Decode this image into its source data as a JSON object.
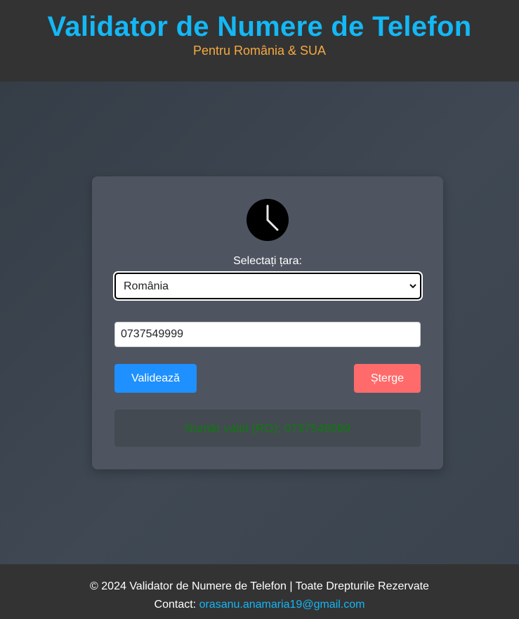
{
  "header": {
    "title": "Validator de Numere de Telefon",
    "subtitle": "Pentru România & SUA"
  },
  "form": {
    "icon": "clock-icon",
    "country_label": "Selectați țara:",
    "country_selected": "România",
    "phone_value": "0737549999",
    "validate_label": "Validează",
    "clear_label": "Șterge",
    "result_text": "Număr valid (RO): 0737549999"
  },
  "footer": {
    "copyright": "© 2024 Validator de Numere de Telefon | Toate Drepturile Rezervate",
    "contact_label": "Contact:",
    "email": "orasanu.anamaria19@gmail.com"
  },
  "colors": {
    "title": "#13b8f6",
    "subtitle": "#f5a941",
    "validate_button": "#1e90ff",
    "clear_button": "#ff6b6b",
    "result_text": "#0e7a0e"
  }
}
